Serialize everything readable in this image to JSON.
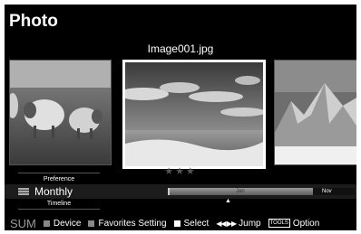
{
  "screen": {
    "title": "Photo",
    "filename": "Image001.jpg",
    "rating": "★★★"
  },
  "view": {
    "preference_label": "Preference",
    "mode_label": "Monthly",
    "timeline_label": "Timeline"
  },
  "timeline": {
    "current_month": "Jan",
    "next_month": "Nov",
    "marker": "▲"
  },
  "footer": {
    "sum": "SUM",
    "device": "Device",
    "favorites": "Favorites Setting",
    "select": "Select",
    "jump_arrows": "◀◀ ▶▶",
    "jump": "Jump",
    "tools": "TOOLS",
    "option": "Option"
  },
  "icons": {
    "view_mode": "list-icon",
    "device": "grey-square-icon",
    "favorites": "grey-square-icon",
    "select": "white-square-icon",
    "jump": "double-arrow-icon"
  },
  "colors": {
    "background": "#000000",
    "text": "#ffffff",
    "selected_border": "#ffffff",
    "button_grey": "#888888"
  }
}
